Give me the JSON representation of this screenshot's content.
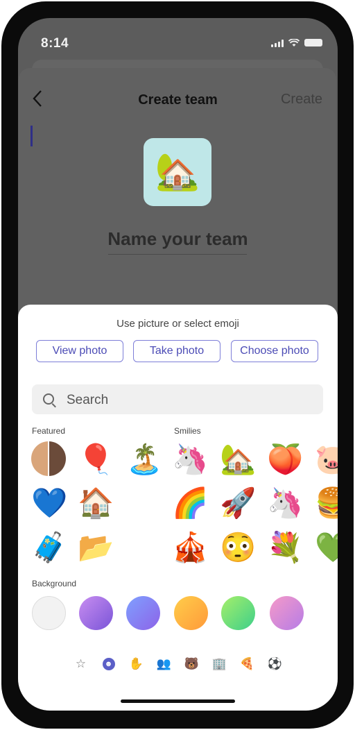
{
  "status_bar": {
    "time": "8:14"
  },
  "header": {
    "back_icon": "chevron-left-icon",
    "title": "Create team",
    "create_label": "Create"
  },
  "team": {
    "icon": "🏡",
    "name_placeholder": "Name your team"
  },
  "picker": {
    "title": "Use picture or select emoji",
    "buttons": [
      "View photo",
      "Take photo",
      "Choose photo"
    ],
    "search_placeholder": "Search",
    "featured_label": "Featured",
    "smilies_label": "Smilies",
    "featured": [
      "🎈",
      "🏝️",
      "💙",
      "🏠",
      "🧳",
      "📂"
    ],
    "smilies": [
      "🦄",
      "🏡",
      "🍑",
      "🐷",
      "🌈",
      "🚀",
      "🦄",
      "🍔",
      "🎪",
      "😳",
      "💐",
      "💚"
    ],
    "background_label": "Background",
    "backgrounds": [
      "#f2f2f2",
      "linear-gradient(135deg,#c88df0,#7a55d8)",
      "linear-gradient(135deg,#7fa0ff,#8d63e8)",
      "linear-gradient(135deg,#ffcd4a,#ff9a3a)",
      "linear-gradient(135deg,#a6ef6a,#3dcf8a)",
      "linear-gradient(135deg,#f59ac8,#b67ce6)"
    ],
    "tabs": [
      "star-icon",
      "smiley-icon",
      "hand-icon",
      "people-icon",
      "animal-icon",
      "building-icon",
      "food-icon",
      "ball-icon"
    ],
    "active_tab": "smiley-icon"
  }
}
